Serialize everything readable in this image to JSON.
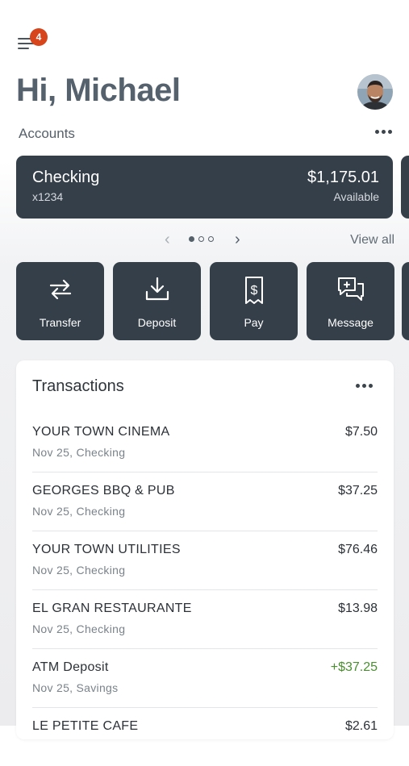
{
  "header": {
    "notification_count": "4",
    "greeting": "Hi, Michael"
  },
  "accounts": {
    "label": "Accounts",
    "cards": [
      {
        "name": "Checking",
        "number": "x1234",
        "balance": "$1,175.01",
        "balance_label": "Available"
      }
    ],
    "pager": {
      "pages": 3,
      "active": 0
    },
    "view_all": "View all"
  },
  "actions": [
    {
      "label": "Transfer",
      "icon": "transfer-icon"
    },
    {
      "label": "Deposit",
      "icon": "deposit-icon"
    },
    {
      "label": "Pay",
      "icon": "pay-icon"
    },
    {
      "label": "Message",
      "icon": "message-icon"
    }
  ],
  "transactions": {
    "title": "Transactions",
    "items": [
      {
        "merchant": "YOUR TOWN CINEMA",
        "meta": "Nov 25, Checking",
        "amount": "$7.50"
      },
      {
        "merchant": "GEORGES BBQ & PUB",
        "meta": "Nov 25, Checking",
        "amount": "$37.25"
      },
      {
        "merchant": "YOUR TOWN UTILITIES",
        "meta": "Nov 25, Checking",
        "amount": "$76.46"
      },
      {
        "merchant": "EL GRAN RESTAURANTE",
        "meta": "Nov 25, Checking",
        "amount": "$13.98"
      },
      {
        "merchant": "ATM Deposit",
        "meta": "Nov 25, Savings",
        "amount": "+$37.25"
      },
      {
        "merchant": "LE PETITE CAFE",
        "meta": "",
        "amount": "$2.61"
      }
    ]
  },
  "colors": {
    "card": "#353f49",
    "badge": "#d6451c",
    "credit": "#4a8f2f"
  }
}
